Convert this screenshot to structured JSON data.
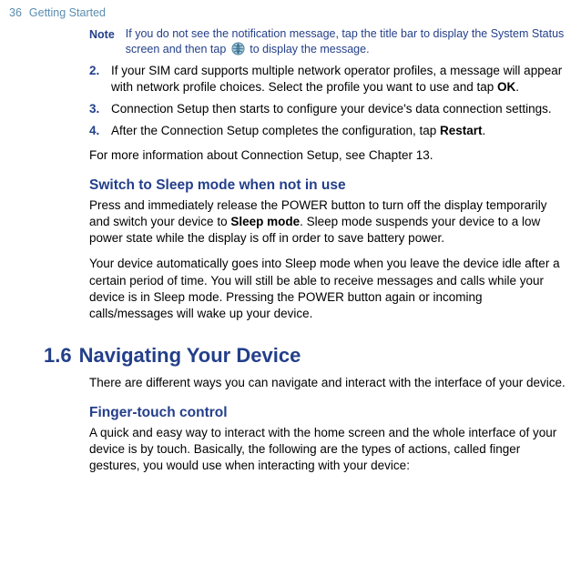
{
  "header": {
    "page_number": "36",
    "section_title": "Getting Started"
  },
  "note": {
    "label": "Note",
    "text_before_icon": "If you do not see the notification message, tap the title bar to display the System Status screen and then tap ",
    "text_after_icon": " to display the message."
  },
  "steps": {
    "s2_num": "2.",
    "s2_a": "If your SIM card supports multiple network operator profiles, a message will appear with network profile choices. Select the profile you want to use and tap ",
    "s2_bold": "OK",
    "s2_b": ".",
    "s3_num": "3.",
    "s3_a": "Connection Setup then starts to configure your device's data connection settings.",
    "s4_num": "4.",
    "s4_a": "After the Connection Setup completes the configuration, tap ",
    "s4_bold": "Restart",
    "s4_b": "."
  },
  "para_more_info": "For more information about Connection Setup, see Chapter 13.",
  "sleep": {
    "heading": "Switch to Sleep mode when not in use",
    "p1_a": "Press and immediately release the POWER button to turn off the display temporarily and switch your device to ",
    "p1_bold": "Sleep mode",
    "p1_b": ". Sleep mode suspends your device to a low power state while the display is off in order to save battery power.",
    "p2": "Your device automatically goes into Sleep mode when you leave the device idle after a certain period of time. You will still be able to receive messages and calls while your device is in Sleep mode. Pressing the POWER button again or incoming calls/messages will wake up your device."
  },
  "nav": {
    "section_num": "1.6",
    "section_title": "Navigating Your Device",
    "intro": "There are different ways you can navigate and interact with the interface of your device.",
    "finger_heading": "Finger-touch control",
    "finger_para": "A quick and easy way to interact with the home screen and the whole interface of your device is by touch. Basically, the following are the types of actions, called finger gestures, you would use when interacting with your device:"
  }
}
